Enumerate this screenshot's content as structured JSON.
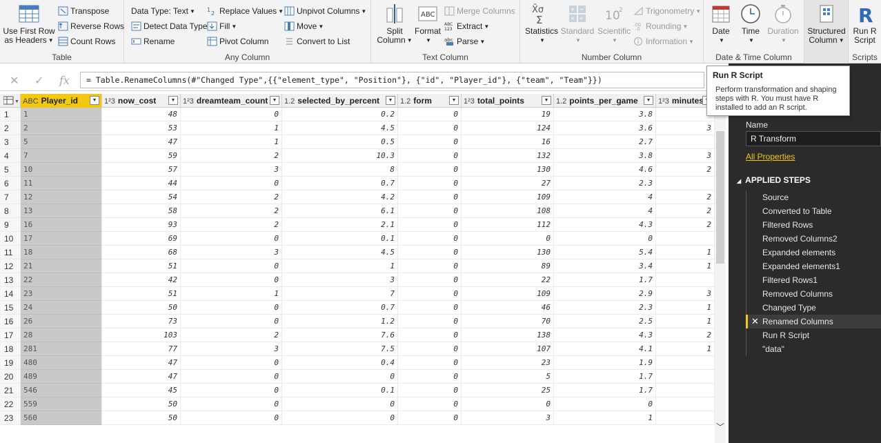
{
  "ribbon": {
    "table": {
      "label": "Table",
      "use_first_row": "Use First Row",
      "use_first_row2": "as Headers",
      "transpose": "Transpose",
      "reverse_rows": "Reverse Rows",
      "count_rows": "Count Rows"
    },
    "any_column": {
      "label": "Any Column",
      "data_type": "Data Type: Text",
      "detect_data_type": "Detect Data Type",
      "rename": "Rename",
      "replace_values": "Replace Values",
      "fill": "Fill",
      "pivot_column": "Pivot Column",
      "unpivot_columns": "Unpivot Columns",
      "move": "Move",
      "convert_to_list": "Convert to List"
    },
    "text_column": {
      "label": "Text Column",
      "split_column": "Split",
      "split_column2": "Column",
      "format": "Format",
      "merge_columns": "Merge Columns",
      "extract": "Extract",
      "parse": "Parse"
    },
    "number_column": {
      "label": "Number Column",
      "statistics": "Statistics",
      "standard": "Standard",
      "scientific": "Scientific",
      "trigonometry": "Trigonometry",
      "rounding": "Rounding",
      "information": "Information"
    },
    "datetime_column": {
      "label": "Date & Time Column",
      "date": "Date",
      "time": "Time",
      "duration": "Duration"
    },
    "structured": {
      "structured_column": "Structured",
      "structured_column2": "Column"
    },
    "scripts": {
      "label": "Scripts",
      "run_r_script": "Run R",
      "run_r_script2": "Script"
    }
  },
  "formula_bar": {
    "formula": "= Table.RenameColumns(#\"Changed Type\",{{\"element_type\", \"Position\"}, {\"id\", \"Player_id\"}, {\"team\", \"Team\"}})"
  },
  "tooltip": {
    "title": "Run R Script",
    "body": "Perform transformation and shaping steps with R. You must have R installed to add an R script."
  },
  "grid": {
    "columns": [
      {
        "type": "ABC",
        "name": "Player_id"
      },
      {
        "type": "1²3",
        "name": "now_cost"
      },
      {
        "type": "1²3",
        "name": "dreamteam_count"
      },
      {
        "type": "1.2",
        "name": "selected_by_percent"
      },
      {
        "type": "1.2",
        "name": "form"
      },
      {
        "type": "1²3",
        "name": "total_points"
      },
      {
        "type": "1.2",
        "name": "points_per_game"
      },
      {
        "type": "1²3",
        "name": "minutes"
      }
    ],
    "rows": [
      [
        "1",
        "1",
        "48",
        "0",
        "0.2",
        "0",
        "19",
        "3.8",
        ""
      ],
      [
        "2",
        "2",
        "53",
        "1",
        "4.5",
        "0",
        "124",
        "3.6",
        "3"
      ],
      [
        "3",
        "5",
        "47",
        "1",
        "0.5",
        "0",
        "16",
        "2.7",
        ""
      ],
      [
        "4",
        "7",
        "59",
        "2",
        "10.3",
        "0",
        "132",
        "3.8",
        "3"
      ],
      [
        "5",
        "10",
        "57",
        "3",
        "8",
        "0",
        "130",
        "4.6",
        "2"
      ],
      [
        "6",
        "11",
        "44",
        "0",
        "0.7",
        "0",
        "27",
        "2.3",
        ""
      ],
      [
        "7",
        "12",
        "54",
        "2",
        "4.2",
        "0",
        "109",
        "4",
        "2"
      ],
      [
        "8",
        "13",
        "58",
        "2",
        "6.1",
        "0",
        "108",
        "4",
        "2"
      ],
      [
        "9",
        "16",
        "93",
        "2",
        "2.1",
        "0",
        "112",
        "4.3",
        "2"
      ],
      [
        "10",
        "17",
        "69",
        "0",
        "0.1",
        "0",
        "0",
        "0",
        ""
      ],
      [
        "11",
        "18",
        "68",
        "3",
        "4.5",
        "0",
        "130",
        "5.4",
        "1"
      ],
      [
        "12",
        "21",
        "51",
        "0",
        "1",
        "0",
        "89",
        "3.4",
        "1"
      ],
      [
        "13",
        "22",
        "42",
        "0",
        "3",
        "0",
        "22",
        "1.7",
        ""
      ],
      [
        "14",
        "23",
        "51",
        "1",
        "7",
        "0",
        "109",
        "2.9",
        "3"
      ],
      [
        "15",
        "24",
        "50",
        "0",
        "0.7",
        "0",
        "46",
        "2.3",
        "1"
      ],
      [
        "16",
        "26",
        "73",
        "0",
        "1.2",
        "0",
        "70",
        "2.5",
        "1"
      ],
      [
        "17",
        "28",
        "103",
        "2",
        "7.6",
        "0",
        "138",
        "4.3",
        "2"
      ],
      [
        "18",
        "281",
        "77",
        "3",
        "7.5",
        "0",
        "107",
        "4.1",
        "1"
      ],
      [
        "19",
        "480",
        "47",
        "0",
        "0.4",
        "0",
        "23",
        "1.9",
        ""
      ],
      [
        "20",
        "489",
        "47",
        "0",
        "0",
        "0",
        "5",
        "1.7",
        ""
      ],
      [
        "21",
        "546",
        "45",
        "0",
        "0.1",
        "0",
        "25",
        "1.7",
        ""
      ],
      [
        "22",
        "559",
        "50",
        "0",
        "0",
        "0",
        "0",
        "0",
        ""
      ],
      [
        "23",
        "560",
        "50",
        "0",
        "0",
        "0",
        "3",
        "1",
        ""
      ]
    ]
  },
  "query_settings": {
    "name_label": "Name",
    "name_value": "R Transform",
    "all_properties": "All Properties",
    "applied_steps_label": "APPLIED STEPS",
    "steps": [
      "Source",
      "Converted to Table",
      "Filtered Rows",
      "Removed Columns2",
      "Expanded elements",
      "Expanded elements1",
      "Filtered Rows1",
      "Removed Columns",
      "Changed Type",
      "Renamed Columns",
      "Run R Script",
      "\"data\""
    ],
    "active_step_index": 9
  },
  "colors": {
    "accent": "#f2c811",
    "pane_bg": "#2b2b2b"
  }
}
